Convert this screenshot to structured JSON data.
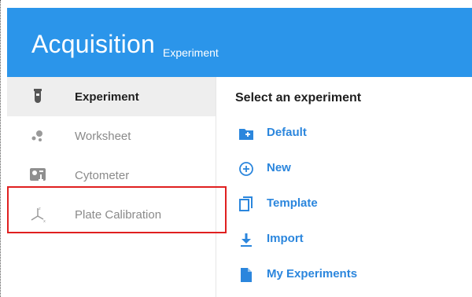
{
  "header": {
    "title": "Acquisition",
    "subtitle": "Experiment",
    "background": "#2b95ea"
  },
  "sidebar": {
    "items": [
      {
        "label": "Experiment",
        "icon": "test-tube-icon",
        "active": true
      },
      {
        "label": "Worksheet",
        "icon": "dots-cluster-icon",
        "active": false
      },
      {
        "label": "Cytometer",
        "icon": "cytometer-icon",
        "active": false
      },
      {
        "label": "Plate Calibration",
        "icon": "axes-icon",
        "active": false
      }
    ]
  },
  "main": {
    "title": "Select an experiment",
    "accent": "#2b86dd",
    "actions": [
      {
        "label": "Default",
        "icon": "folder-add-icon"
      },
      {
        "label": "New",
        "icon": "circle-plus-icon"
      },
      {
        "label": "Template",
        "icon": "copy-icon"
      },
      {
        "label": "Import",
        "icon": "download-icon"
      },
      {
        "label": "My Experiments",
        "icon": "document-icon"
      }
    ]
  },
  "annotation": {
    "highlight_color": "#e02020",
    "highlighted_item": "Plate Calibration"
  }
}
